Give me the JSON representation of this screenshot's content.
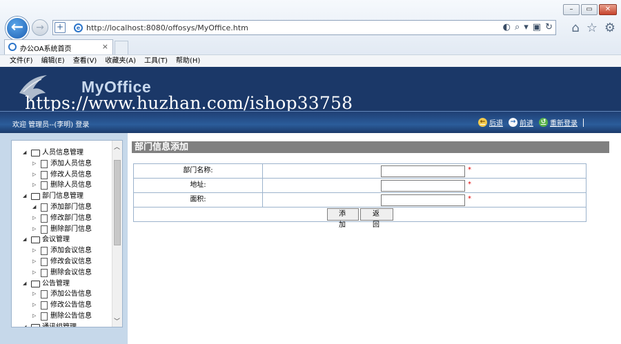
{
  "browser": {
    "address_url": "http://localhost:8080/offosys/MyOffice.htm",
    "tab_title": "办公OA系统首页",
    "tab_close": "×",
    "menu": [
      "文件(F)",
      "编辑(E)",
      "查看(V)",
      "收藏夹(A)",
      "工具(T)",
      "帮助(H)"
    ]
  },
  "header": {
    "logo_text": "MyOffice",
    "watermark": "https://www.huzhan.com/ishop33758",
    "welcome": "欢迎 管理员--(李明) 登录",
    "nav": [
      "后退",
      "前进",
      "重新登录"
    ]
  },
  "sidebar": {
    "tree": [
      {
        "label": "人员信息管理",
        "level": 0,
        "expanded": true
      },
      {
        "label": "添加人员信息",
        "level": 1
      },
      {
        "label": "修改人员信息",
        "level": 1
      },
      {
        "label": "删除人员信息",
        "level": 1
      },
      {
        "label": "部门信息管理",
        "level": 0,
        "expanded": true
      },
      {
        "label": "添加部门信息",
        "level": 1,
        "expanded": true
      },
      {
        "label": "修改部门信息",
        "level": 1
      },
      {
        "label": "删除部门信息",
        "level": 1
      },
      {
        "label": "会议管理",
        "level": 0,
        "expanded": true
      },
      {
        "label": "添加会议信息",
        "level": 1
      },
      {
        "label": "修改会议信息",
        "level": 1
      },
      {
        "label": "删除会议信息",
        "level": 1
      },
      {
        "label": "公告管理",
        "level": 0,
        "expanded": true
      },
      {
        "label": "添加公告信息",
        "level": 1
      },
      {
        "label": "修改公告信息",
        "level": 1
      },
      {
        "label": "删除公告信息",
        "level": 1
      },
      {
        "label": "通讯组管理",
        "level": 0,
        "expanded": true
      }
    ]
  },
  "main": {
    "title": "部门信息添加",
    "fields": [
      {
        "label": "部门名称:",
        "value": "",
        "required": "*"
      },
      {
        "label": "地址:",
        "value": "",
        "required": "*"
      },
      {
        "label": "面积:",
        "value": "",
        "required": "*"
      }
    ],
    "add_button": "添 加",
    "back_button": "返 回"
  }
}
